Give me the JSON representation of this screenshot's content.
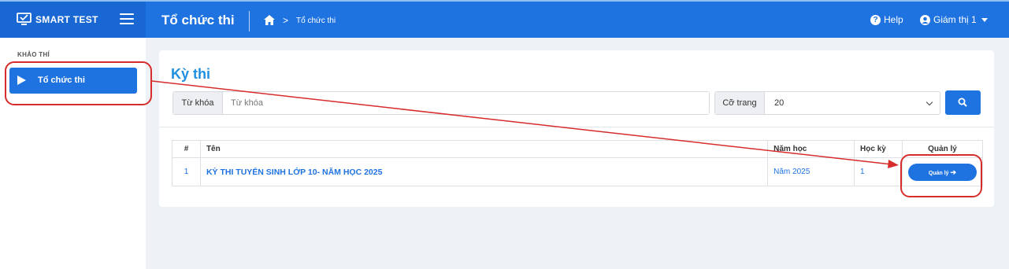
{
  "header": {
    "brand": "SMART TEST",
    "page_title": "Tổ chức thi",
    "breadcrumb_current": "Tổ chức thi",
    "help_label": "Help",
    "user_label": "Giám thị 1",
    "colors": {
      "bar": "#1f73e0",
      "brand_bg": "#1967d2"
    }
  },
  "sidebar": {
    "section_label": "KHẢO THÍ",
    "items": [
      {
        "label": "Tổ chức thi",
        "icon": "play-icon",
        "active": true
      }
    ]
  },
  "main": {
    "title": "Kỳ thi",
    "keyword": {
      "label": "Từ khóa",
      "placeholder": "Từ khóa",
      "value": ""
    },
    "page_size": {
      "label": "Cỡ trang",
      "value": "20"
    },
    "table": {
      "headers": [
        "#",
        "Tên",
        "Năm học",
        "Học kỳ",
        "Quản lý"
      ],
      "rows": [
        {
          "index": "1",
          "name": "KỲ THI TUYỂN SINH LỚP 10- NĂM HỌC 2025",
          "year": "Năm 2025",
          "term": "1",
          "action": "Quản lý"
        }
      ]
    }
  },
  "annotation_color": "#d62c2c"
}
